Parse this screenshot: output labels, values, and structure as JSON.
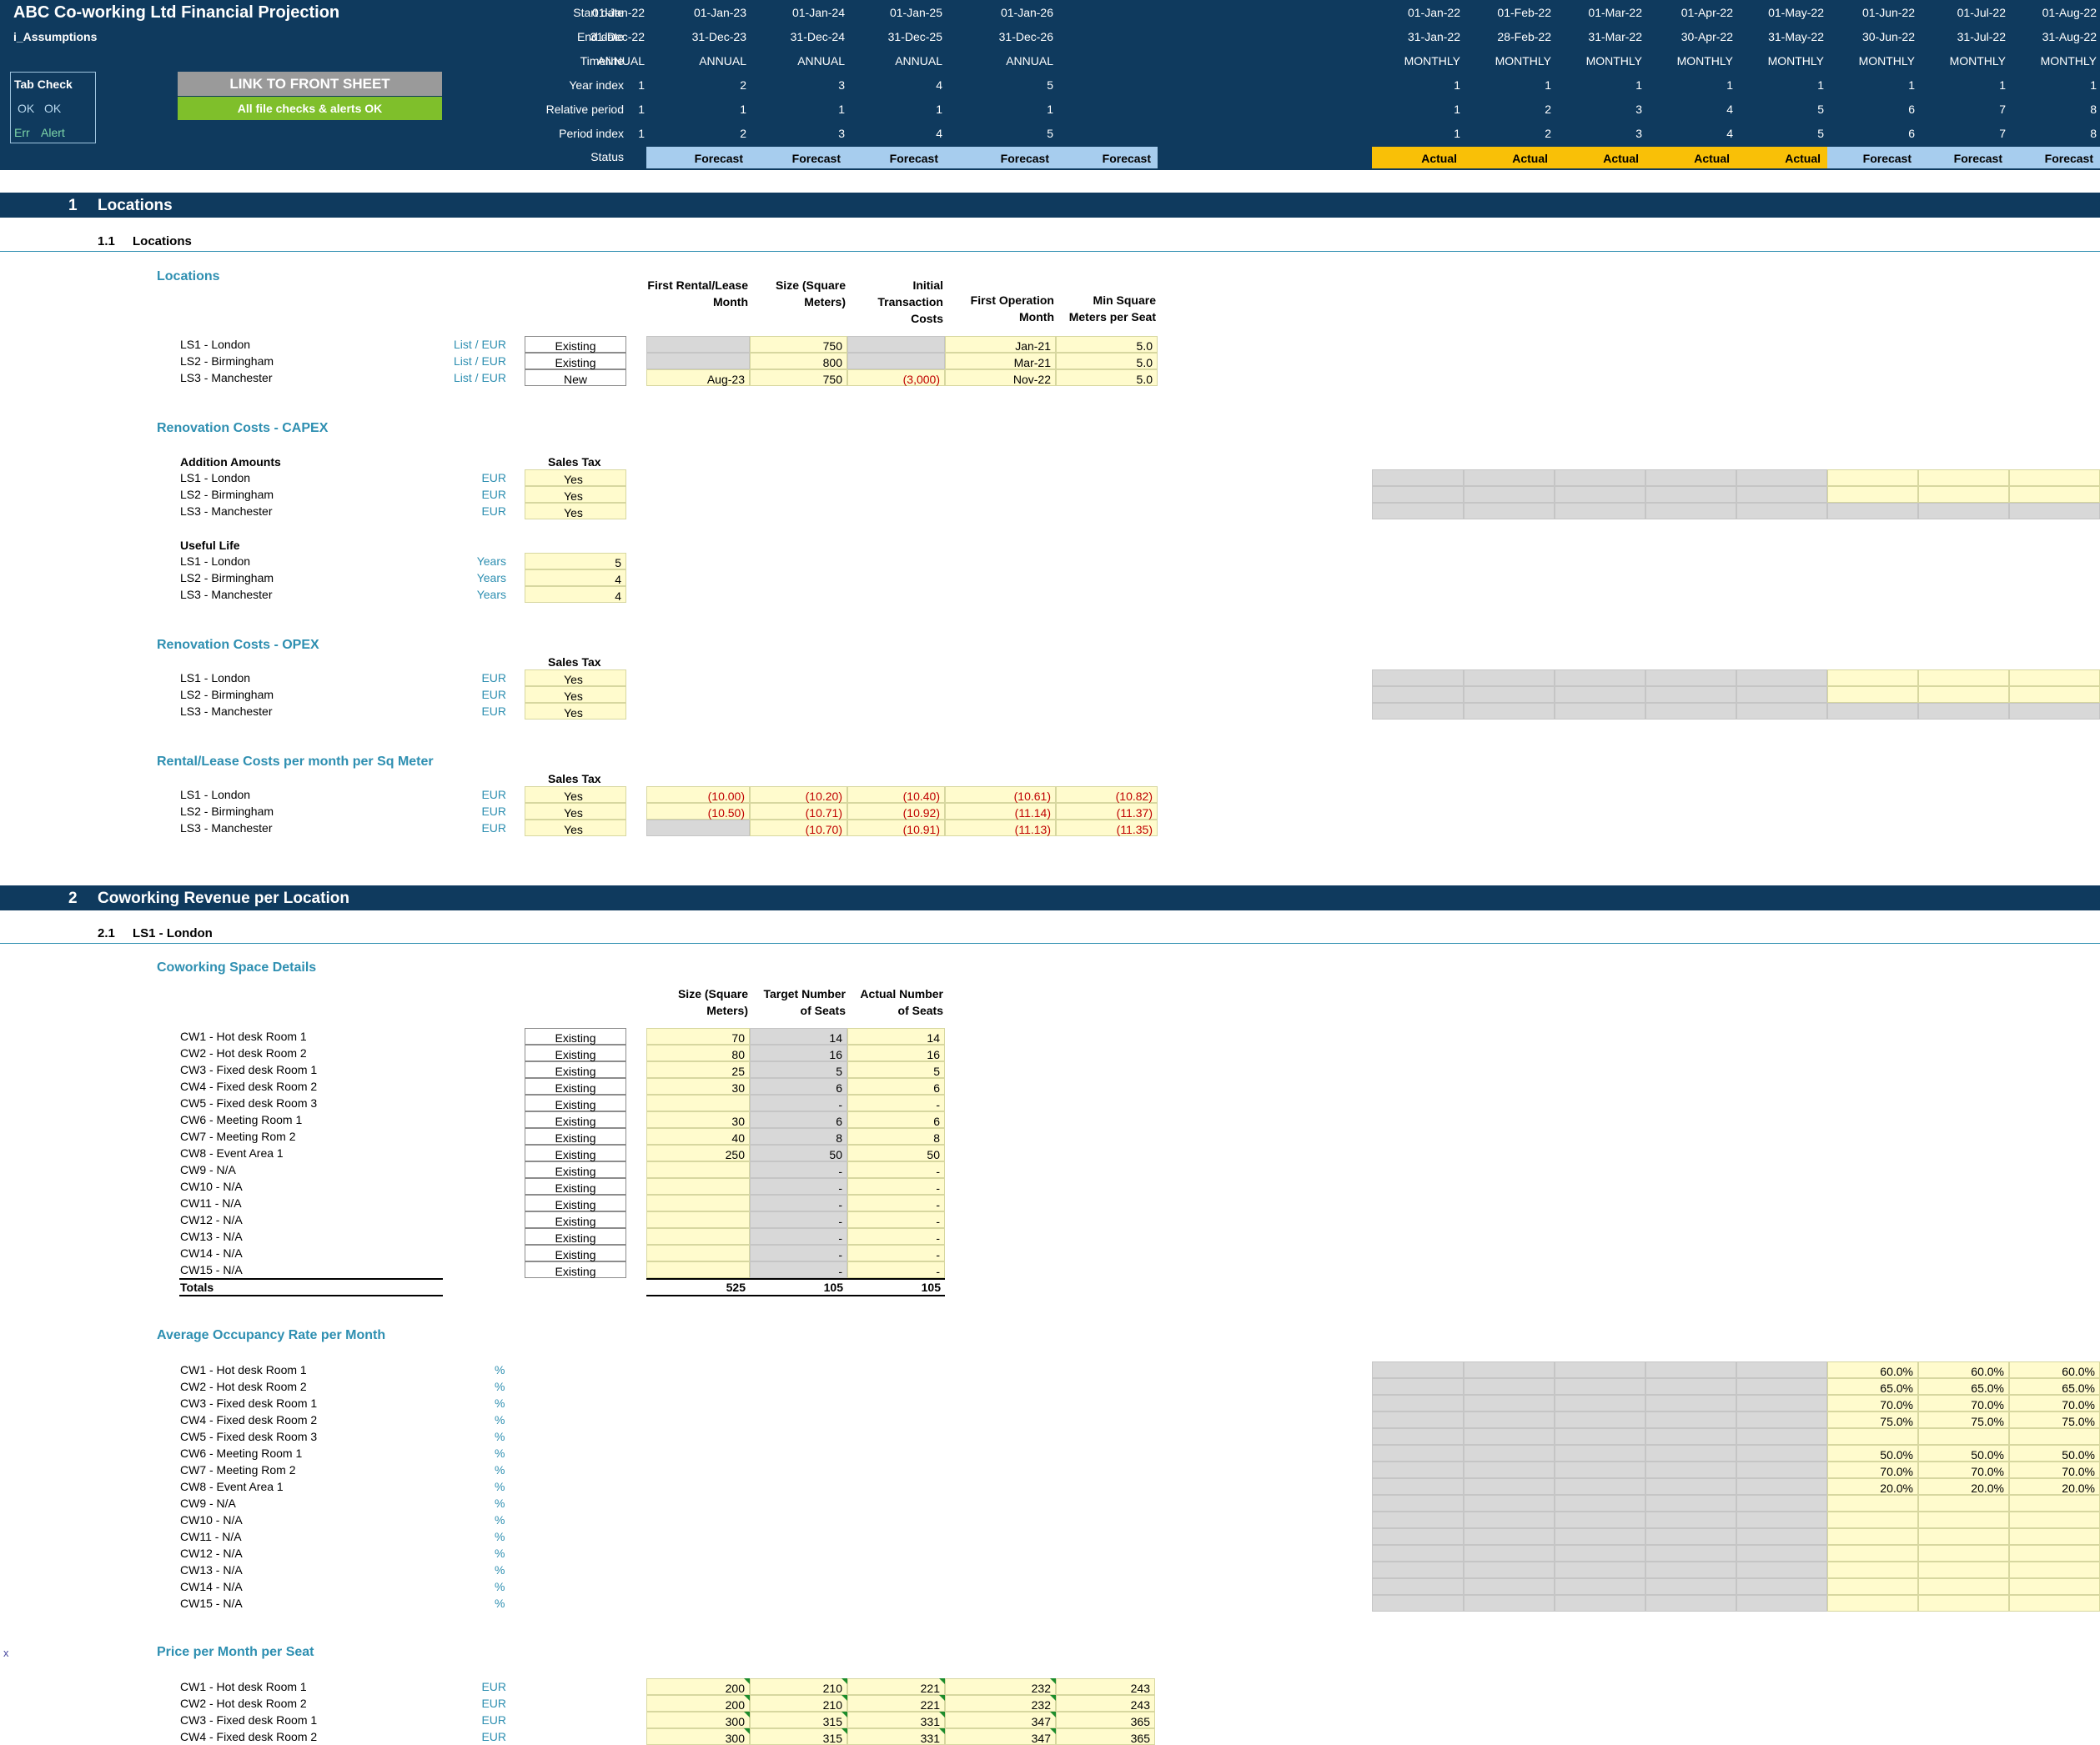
{
  "header": {
    "title": "ABC Co-working Ltd Financial Projection",
    "sheet": "i_Assumptions",
    "row_labels": [
      "Start date",
      "End date",
      "Timeline",
      "Year index",
      "Relative period",
      "Period index",
      "Status"
    ],
    "annual": [
      {
        "start": "01-Jan-22",
        "end": "31-Dec-22",
        "timeline": "ANNUAL",
        "year": "1",
        "rel": "1",
        "idx": "1",
        "status": "Forecast"
      },
      {
        "start": "01-Jan-23",
        "end": "31-Dec-23",
        "timeline": "ANNUAL",
        "year": "2",
        "rel": "1",
        "idx": "2",
        "status": "Forecast"
      },
      {
        "start": "01-Jan-24",
        "end": "31-Dec-24",
        "timeline": "ANNUAL",
        "year": "3",
        "rel": "1",
        "idx": "3",
        "status": "Forecast"
      },
      {
        "start": "01-Jan-25",
        "end": "31-Dec-25",
        "timeline": "ANNUAL",
        "year": "4",
        "rel": "1",
        "idx": "4",
        "status": "Forecast"
      },
      {
        "start": "01-Jan-26",
        "end": "31-Dec-26",
        "timeline": "ANNUAL",
        "year": "5",
        "rel": "1",
        "idx": "5",
        "status": "Forecast"
      }
    ],
    "monthly": [
      {
        "start": "01-Jan-22",
        "end": "31-Jan-22",
        "timeline": "MONTHLY",
        "year": "1",
        "rel": "1",
        "idx": "1",
        "status": "Actual"
      },
      {
        "start": "01-Feb-22",
        "end": "28-Feb-22",
        "timeline": "MONTHLY",
        "year": "1",
        "rel": "2",
        "idx": "2",
        "status": "Actual"
      },
      {
        "start": "01-Mar-22",
        "end": "31-Mar-22",
        "timeline": "MONTHLY",
        "year": "1",
        "rel": "3",
        "idx": "3",
        "status": "Actual"
      },
      {
        "start": "01-Apr-22",
        "end": "30-Apr-22",
        "timeline": "MONTHLY",
        "year": "1",
        "rel": "4",
        "idx": "4",
        "status": "Actual"
      },
      {
        "start": "01-May-22",
        "end": "31-May-22",
        "timeline": "MONTHLY",
        "year": "1",
        "rel": "5",
        "idx": "5",
        "status": "Actual"
      },
      {
        "start": "01-Jun-22",
        "end": "30-Jun-22",
        "timeline": "MONTHLY",
        "year": "1",
        "rel": "6",
        "idx": "6",
        "status": "Forecast"
      },
      {
        "start": "01-Jul-22",
        "end": "31-Jul-22",
        "timeline": "MONTHLY",
        "year": "1",
        "rel": "7",
        "idx": "7",
        "status": "Forecast"
      },
      {
        "start": "01-Aug-22",
        "end": "31-Aug-22",
        "timeline": "MONTHLY",
        "year": "1",
        "rel": "8",
        "idx": "8",
        "status": "Forecast"
      }
    ],
    "tab_check": {
      "title": "Tab Check",
      "ok1": "OK",
      "ok2": "OK",
      "err": "Err",
      "alert": "Alert"
    },
    "link_button": "LINK TO FRONT SHEET",
    "checks_ok": "All file checks & alerts OK"
  },
  "sections": [
    {
      "num": "1",
      "title": "Locations"
    },
    {
      "num": "2",
      "title": "Coworking Revenue per Location"
    }
  ],
  "subsections": [
    {
      "num": "1.1",
      "title": "Locations"
    },
    {
      "num": "2.1",
      "title": "LS1 - London"
    }
  ],
  "locations": {
    "group": "Locations",
    "col_headers": [
      "First Rental/Lease Month",
      "Size (Square Meters)",
      "Initial Transaction Costs",
      "First Operation Month",
      "Min Square Meters per Seat"
    ],
    "rows": [
      {
        "name": "LS1 - London",
        "unit": "List / EUR",
        "status": "Existing",
        "first_rental": "",
        "size": "750",
        "itc": "",
        "first_op": "Jan-21",
        "min_sqm": "5.0"
      },
      {
        "name": "LS2 - Birmingham",
        "unit": "List / EUR",
        "status": "Existing",
        "first_rental": "",
        "size": "800",
        "itc": "",
        "first_op": "Mar-21",
        "min_sqm": "5.0"
      },
      {
        "name": "LS3 - Manchester",
        "unit": "List / EUR",
        "status": "New",
        "first_rental": "Aug-23",
        "size": "750",
        "itc": "(3,000)",
        "first_op": "Nov-22",
        "min_sqm": "5.0"
      }
    ]
  },
  "capex": {
    "group": "Renovation Costs - CAPEX",
    "addition_label": "Addition Amounts",
    "sales_tax_header": "Sales Tax",
    "rows": [
      {
        "name": "LS1 - London",
        "unit": "EUR",
        "tax": "Yes"
      },
      {
        "name": "LS2 - Birmingham",
        "unit": "EUR",
        "tax": "Yes"
      },
      {
        "name": "LS3 - Manchester",
        "unit": "EUR",
        "tax": "Yes"
      }
    ],
    "useful_life_label": "Useful Life",
    "useful_life": [
      {
        "name": "LS1 - London",
        "unit": "Years",
        "value": "5"
      },
      {
        "name": "LS2 - Birmingham",
        "unit": "Years",
        "value": "4"
      },
      {
        "name": "LS3 - Manchester",
        "unit": "Years",
        "value": "4"
      }
    ]
  },
  "opex": {
    "group": "Renovation Costs - OPEX",
    "sales_tax_header": "Sales Tax",
    "rows": [
      {
        "name": "LS1 - London",
        "unit": "EUR",
        "tax": "Yes"
      },
      {
        "name": "LS2 - Birmingham",
        "unit": "EUR",
        "tax": "Yes"
      },
      {
        "name": "LS3 - Manchester",
        "unit": "EUR",
        "tax": "Yes"
      }
    ]
  },
  "rental": {
    "group": "Rental/Lease Costs per month per Sq Meter",
    "sales_tax_header": "Sales Tax",
    "rows": [
      {
        "name": "LS1 - London",
        "unit": "EUR",
        "tax": "Yes",
        "values": [
          "(10.00)",
          "(10.20)",
          "(10.40)",
          "(10.61)",
          "(10.82)"
        ]
      },
      {
        "name": "LS2 - Birmingham",
        "unit": "EUR",
        "tax": "Yes",
        "values": [
          "(10.50)",
          "(10.71)",
          "(10.92)",
          "(11.14)",
          "(11.37)"
        ]
      },
      {
        "name": "LS3 - Manchester",
        "unit": "EUR",
        "tax": "Yes",
        "values": [
          "",
          "(10.70)",
          "(10.91)",
          "(11.13)",
          "(11.35)"
        ]
      }
    ]
  },
  "coworking": {
    "group": "Coworking Space Details",
    "col_headers": [
      "Size (Square Meters)",
      "Target Number of Seats",
      "Actual Number of Seats"
    ],
    "rows": [
      {
        "name": "CW1 - Hot desk Room 1",
        "status": "Existing",
        "size": "70",
        "target": "14",
        "actual": "14"
      },
      {
        "name": "CW2 - Hot desk Room 2",
        "status": "Existing",
        "size": "80",
        "target": "16",
        "actual": "16"
      },
      {
        "name": "CW3 - Fixed desk Room 1",
        "status": "Existing",
        "size": "25",
        "target": "5",
        "actual": "5"
      },
      {
        "name": "CW4 - Fixed desk Room 2",
        "status": "Existing",
        "size": "30",
        "target": "6",
        "actual": "6"
      },
      {
        "name": "CW5 - Fixed desk Room 3",
        "status": "Existing",
        "size": "",
        "target": "-",
        "actual": "-"
      },
      {
        "name": "CW6 - Meeting Room 1",
        "status": "Existing",
        "size": "30",
        "target": "6",
        "actual": "6"
      },
      {
        "name": "CW7 - Meeting Rom 2",
        "status": "Existing",
        "size": "40",
        "target": "8",
        "actual": "8"
      },
      {
        "name": "CW8 - Event Area 1",
        "status": "Existing",
        "size": "250",
        "target": "50",
        "actual": "50"
      },
      {
        "name": "CW9 - N/A",
        "status": "Existing",
        "size": "",
        "target": "-",
        "actual": "-"
      },
      {
        "name": "CW10 - N/A",
        "status": "Existing",
        "size": "",
        "target": "-",
        "actual": "-"
      },
      {
        "name": "CW11 - N/A",
        "status": "Existing",
        "size": "",
        "target": "-",
        "actual": "-"
      },
      {
        "name": "CW12 - N/A",
        "status": "Existing",
        "size": "",
        "target": "-",
        "actual": "-"
      },
      {
        "name": "CW13 - N/A",
        "status": "Existing",
        "size": "",
        "target": "-",
        "actual": "-"
      },
      {
        "name": "CW14 - N/A",
        "status": "Existing",
        "size": "",
        "target": "-",
        "actual": "-"
      },
      {
        "name": "CW15 - N/A",
        "status": "Existing",
        "size": "",
        "target": "-",
        "actual": "-"
      }
    ],
    "totals": {
      "label": "Totals",
      "size": "525",
      "target": "105",
      "actual": "105"
    }
  },
  "occupancy": {
    "group": "Average Occupancy Rate per Month",
    "unit": "%",
    "rows": [
      {
        "name": "CW1 - Hot desk Room 1",
        "values": [
          "60.0%",
          "60.0%",
          "60.0%"
        ]
      },
      {
        "name": "CW2 - Hot desk Room 2",
        "values": [
          "65.0%",
          "65.0%",
          "65.0%"
        ]
      },
      {
        "name": "CW3 - Fixed desk Room 1",
        "values": [
          "70.0%",
          "70.0%",
          "70.0%"
        ]
      },
      {
        "name": "CW4 - Fixed desk Room 2",
        "values": [
          "75.0%",
          "75.0%",
          "75.0%"
        ]
      },
      {
        "name": "CW5 - Fixed desk Room 3",
        "values": [
          "",
          "",
          ""
        ]
      },
      {
        "name": "CW6 - Meeting Room 1",
        "values": [
          "50.0%",
          "50.0%",
          "50.0%"
        ]
      },
      {
        "name": "CW7 - Meeting Rom 2",
        "values": [
          "70.0%",
          "70.0%",
          "70.0%"
        ]
      },
      {
        "name": "CW8 - Event Area 1",
        "values": [
          "20.0%",
          "20.0%",
          "20.0%"
        ]
      },
      {
        "name": "CW9 - N/A",
        "values": [
          "",
          "",
          ""
        ]
      },
      {
        "name": "CW10 - N/A",
        "values": [
          "",
          "",
          ""
        ]
      },
      {
        "name": "CW11 - N/A",
        "values": [
          "",
          "",
          ""
        ]
      },
      {
        "name": "CW12 - N/A",
        "values": [
          "",
          "",
          ""
        ]
      },
      {
        "name": "CW13 - N/A",
        "values": [
          "",
          "",
          ""
        ]
      },
      {
        "name": "CW14 - N/A",
        "values": [
          "",
          "",
          ""
        ]
      },
      {
        "name": "CW15 - N/A",
        "values": [
          "",
          "",
          ""
        ]
      }
    ]
  },
  "price": {
    "group": "Price per Month per Seat",
    "marker": "x",
    "rows": [
      {
        "name": "CW1 - Hot desk Room 1",
        "unit": "EUR",
        "values": [
          "200",
          "210",
          "221",
          "232",
          "243"
        ]
      },
      {
        "name": "CW2 - Hot desk Room 2",
        "unit": "EUR",
        "values": [
          "200",
          "210",
          "221",
          "232",
          "243"
        ]
      },
      {
        "name": "CW3 - Fixed desk Room 1",
        "unit": "EUR",
        "values": [
          "300",
          "315",
          "331",
          "347",
          "365"
        ]
      },
      {
        "name": "CW4 - Fixed desk Room 2",
        "unit": "EUR",
        "values": [
          "300",
          "315",
          "331",
          "347",
          "365"
        ]
      }
    ]
  },
  "colors": {
    "navy": "#0f3a5e",
    "teal": "#2e8fb1",
    "input_yellow": "#fffbcd",
    "calc_grey": "#d8d8d8",
    "forecast": "#a7cdee",
    "actual": "#f9c007",
    "negative": "#c00000",
    "ok_green": "#7fbf2b"
  }
}
